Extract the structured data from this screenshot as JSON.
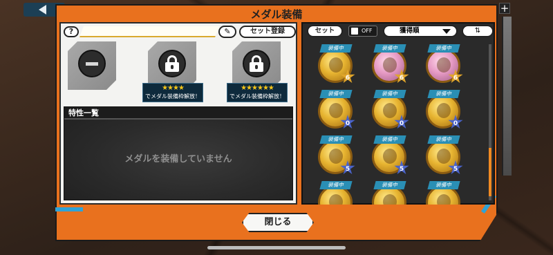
{
  "dialog": {
    "title": "メダル装備"
  },
  "left": {
    "help_label": "?",
    "set_register_label": "セット登録",
    "slots": [
      {
        "state": "empty"
      },
      {
        "state": "locked",
        "stars": "★★★★",
        "unlock_text": "でメダル装備枠解放！"
      },
      {
        "state": "locked",
        "stars": "★★★★★★",
        "unlock_text": "でメダル装備枠解放！"
      }
    ],
    "traits": {
      "heading": "特性一覧",
      "empty_message": "メダルを装備していません"
    }
  },
  "right": {
    "set_label": "セット",
    "off_label": "OFF",
    "sort_label": "獲得順",
    "medals": [
      {
        "tag": "装備中",
        "color": "gold",
        "badge": "6",
        "badge_color": "gold"
      },
      {
        "tag": "装備中",
        "color": "pink",
        "badge": "6",
        "badge_color": "gold"
      },
      {
        "tag": "装備中",
        "color": "pink",
        "badge": "6",
        "badge_color": "gold"
      },
      {
        "tag": "装備中",
        "color": "gold",
        "badge": "0",
        "badge_color": "blue"
      },
      {
        "tag": "装備中",
        "color": "gold",
        "badge": "0",
        "badge_color": "blue"
      },
      {
        "tag": "装備中",
        "color": "gold",
        "badge": "0",
        "badge_color": "blue"
      },
      {
        "tag": "装備中",
        "color": "gold",
        "badge": "5",
        "badge_color": "blue"
      },
      {
        "tag": "装備中",
        "color": "gold",
        "badge": "5",
        "badge_color": "blue"
      },
      {
        "tag": "装備中",
        "color": "gold",
        "badge": "5",
        "badge_color": "blue"
      },
      {
        "tag": "装備中",
        "color": "gold",
        "badge": "",
        "badge_color": "blue"
      },
      {
        "tag": "装備中",
        "color": "gold",
        "badge": "",
        "badge_color": "blue"
      },
      {
        "tag": "装備中",
        "color": "gold",
        "badge": "",
        "badge_color": "blue"
      }
    ]
  },
  "close_label": "閉じる",
  "colors": {
    "accent": "#e9711e",
    "highlight": "#30a3d6"
  }
}
